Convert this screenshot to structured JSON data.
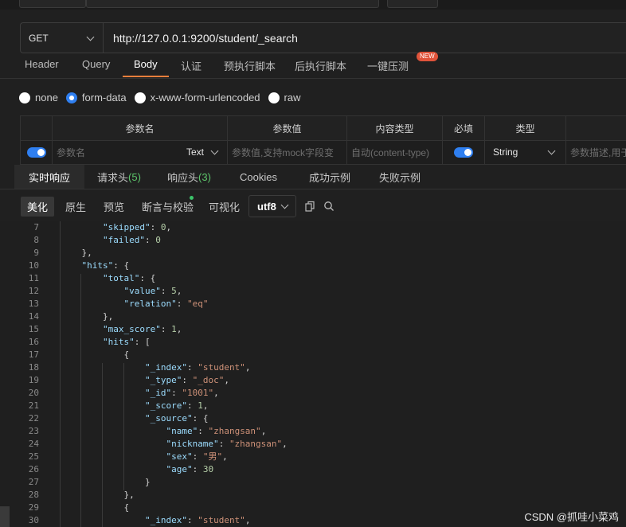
{
  "request": {
    "method": "GET",
    "url": "http://127.0.0.1:9200/student/_search"
  },
  "request_tabs": [
    {
      "label": "Header"
    },
    {
      "label": "Query"
    },
    {
      "label": "Body"
    },
    {
      "label": "认证"
    },
    {
      "label": "预执行脚本"
    },
    {
      "label": "后执行脚本"
    },
    {
      "label": "一键压测"
    }
  ],
  "new_badge": "NEW",
  "body_types": [
    {
      "label": "none"
    },
    {
      "label": "form-data"
    },
    {
      "label": "x-www-form-urlencoded"
    },
    {
      "label": "raw"
    }
  ],
  "params_table": {
    "headers": [
      "参数名",
      "参数值",
      "内容类型",
      "必填",
      "类型"
    ],
    "row": {
      "name_placeholder": "参数名",
      "name_type": "Text",
      "value_placeholder": "参数值,支持mock字段变",
      "content_type_placeholder": "自动(content-type)",
      "type": "String",
      "desc_placeholder": "参数描述,用于"
    }
  },
  "response_tabs": {
    "realtime": "实时响应",
    "req_headers": "请求头",
    "req_headers_count": "(5)",
    "resp_headers": "响应头",
    "resp_headers_count": "(3)",
    "cookies": "Cookies",
    "success": "成功示例",
    "failure": "失败示例"
  },
  "view_modes": {
    "pretty": "美化",
    "raw": "原生",
    "preview": "预览",
    "assert": "断言与校验",
    "visual": "可视化"
  },
  "encoding": "utf8",
  "code_lines": [
    {
      "n": "7"
    },
    {
      "n": "8"
    },
    {
      "n": "9"
    },
    {
      "n": "10"
    },
    {
      "n": "11"
    },
    {
      "n": "12"
    },
    {
      "n": "13"
    },
    {
      "n": "14"
    },
    {
      "n": "15"
    },
    {
      "n": "16"
    },
    {
      "n": "17"
    },
    {
      "n": "18"
    },
    {
      "n": "19"
    },
    {
      "n": "20"
    },
    {
      "n": "21"
    },
    {
      "n": "22"
    },
    {
      "n": "23"
    },
    {
      "n": "24"
    },
    {
      "n": "25"
    },
    {
      "n": "26"
    },
    {
      "n": "27"
    },
    {
      "n": "28"
    },
    {
      "n": "29"
    },
    {
      "n": "30"
    }
  ],
  "watermark": "CSDN @抓哇小菜鸡"
}
